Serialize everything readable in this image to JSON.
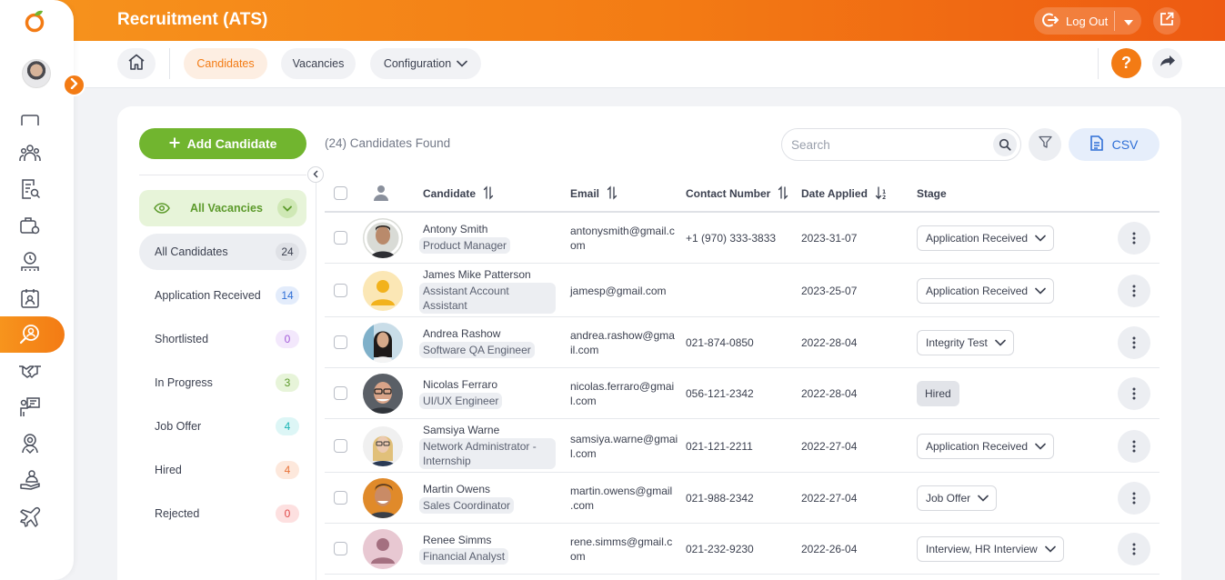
{
  "header": {
    "title": "Recruitment (ATS)",
    "logout_label": "Log Out",
    "brand_color": "#f37b14"
  },
  "subnav": {
    "tabs": [
      {
        "label": "Candidates",
        "active": true
      },
      {
        "label": "Vacancies",
        "active": false
      },
      {
        "label": "Configuration",
        "active": false
      }
    ],
    "help_label": "?"
  },
  "toolbar": {
    "add_candidate_label": "Add Candidate",
    "found_label": "(24) Candidates Found",
    "search_placeholder": "Search",
    "csv_label": "CSV"
  },
  "filters": {
    "vacancy_selector": "All Vacancies",
    "stages": [
      {
        "label": "All Candidates",
        "count": "24",
        "color": "#3c4150",
        "bg": "#dfe1e6",
        "active": true
      },
      {
        "label": "Application Received",
        "count": "14",
        "color": "#2f6fd6",
        "bg": "#e3ecfb"
      },
      {
        "label": "Shortlisted",
        "count": "0",
        "color": "#a35bd9",
        "bg": "#f3e8fc"
      },
      {
        "label": "In Progress",
        "count": "3",
        "color": "#5c9a2b",
        "bg": "#e7f4d9"
      },
      {
        "label": "Job Offer",
        "count": "4",
        "color": "#1bb5b5",
        "bg": "#ddf6f6"
      },
      {
        "label": "Hired",
        "count": "4",
        "color": "#e8733a",
        "bg": "#fde8dc"
      },
      {
        "label": "Rejected",
        "count": "0",
        "color": "#e04848",
        "bg": "#fde0e0"
      }
    ]
  },
  "table": {
    "columns": {
      "candidate": "Candidate",
      "email": "Email",
      "contact": "Contact Number",
      "date": "Date Applied",
      "stage": "Stage"
    },
    "rows": [
      {
        "name": "Antony Smith",
        "role_lines": [
          "Product Manager"
        ],
        "email_lines": [
          "antonysmith@gmail.c",
          "om"
        ],
        "phone": "+1 (970) 333-3833",
        "date": "2023-31-07",
        "stage": "Application Received",
        "stage_dropdown": true,
        "photo": "man-dark"
      },
      {
        "name": "James Mike Patterson",
        "role_lines": [
          "Assistant Account",
          "Assistant"
        ],
        "email_lines": [
          "jamesp@gmail.com"
        ],
        "phone": "",
        "date": "2023-25-07",
        "stage": "Application Received",
        "stage_dropdown": true,
        "photo": "placeholder"
      },
      {
        "name": "Andrea Rashow",
        "role_lines": [
          "Software QA Engineer"
        ],
        "email_lines": [
          "andrea.rashow@gma",
          "il.com"
        ],
        "phone": "021-874-0850",
        "date": "2022-28-04",
        "stage": "Integrity Test",
        "stage_dropdown": true,
        "photo": "woman-dark"
      },
      {
        "name": "Nicolas Ferraro",
        "role_lines": [
          "UI/UX Engineer"
        ],
        "email_lines": [
          "nicolas.ferraro@gmai",
          "l.com"
        ],
        "phone": "056-121-2342",
        "date": "2022-28-04",
        "stage": "Hired",
        "stage_dropdown": false,
        "photo": "man-glasses"
      },
      {
        "name": "Samsiya Warne",
        "role_lines": [
          "Network Administrator -",
          "Internship"
        ],
        "email_lines": [
          "samsiya.warne@gmai",
          "l.com"
        ],
        "phone": "021-121-2211",
        "date": "2022-27-04",
        "stage": "Application Received",
        "stage_dropdown": true,
        "photo": "woman-blonde"
      },
      {
        "name": "Martin Owens",
        "role_lines": [
          "Sales Coordinator"
        ],
        "email_lines": [
          "martin.owens@gmail",
          ".com"
        ],
        "phone": "021-988-2342",
        "date": "2022-27-04",
        "stage": "Job Offer",
        "stage_dropdown": true,
        "photo": "man-smile"
      },
      {
        "name": "Renee Simms",
        "role_lines": [
          "Financial Analyst"
        ],
        "email_lines": [
          "rene.simms@gmail.c",
          "om"
        ],
        "phone": "021-232-9230",
        "date": "2022-26-04",
        "stage": "Interview, HR Interview",
        "stage_dropdown": true,
        "photo": "placeholder-pink"
      }
    ]
  }
}
